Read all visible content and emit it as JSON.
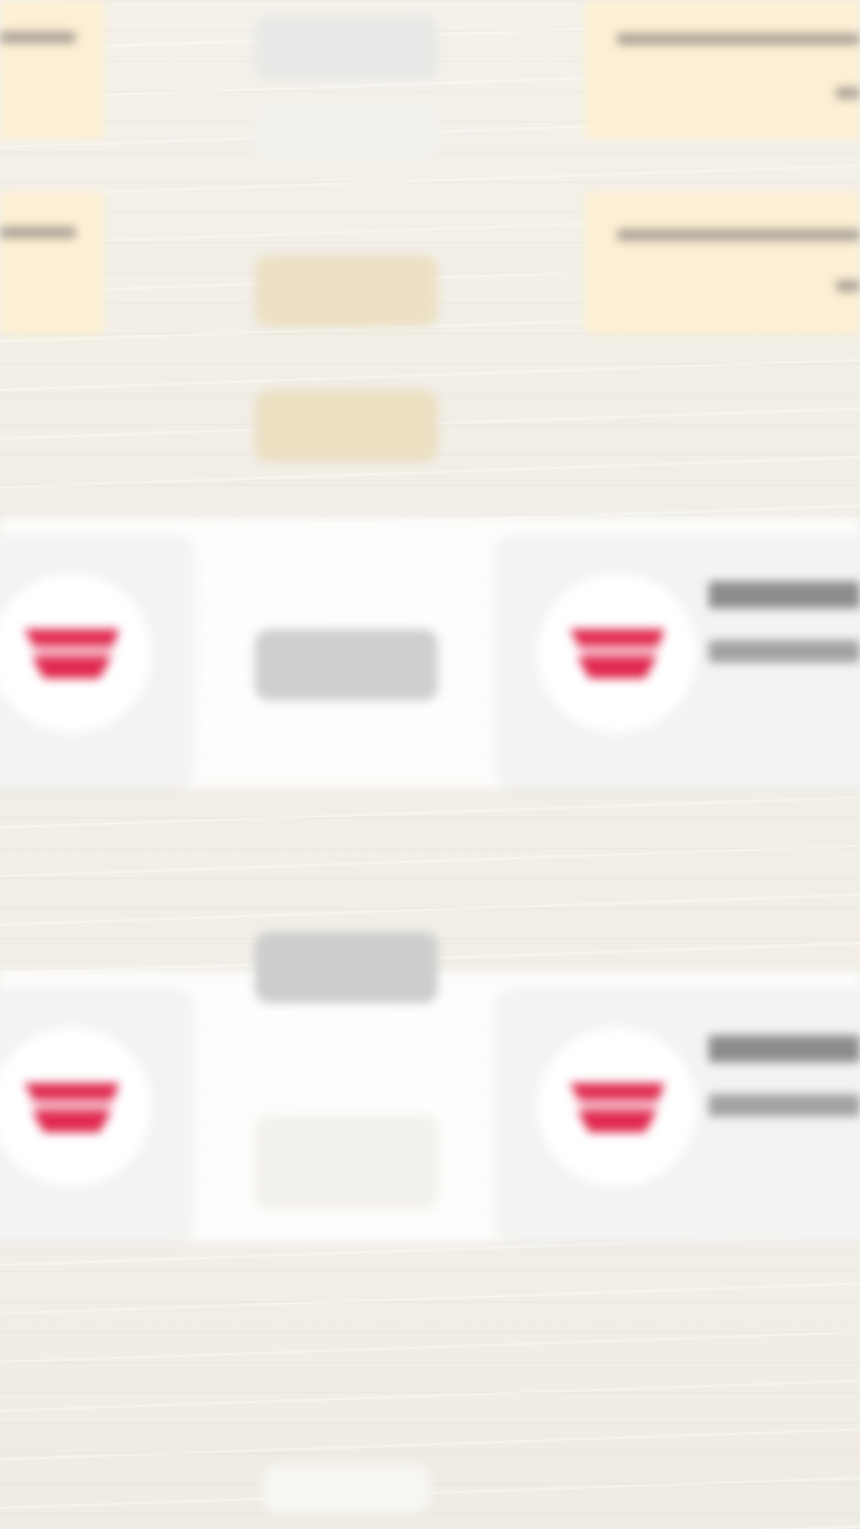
{
  "colors": {
    "background": "#f1efe8",
    "note_background": "#fdefd3",
    "card_background": "#f4f3f2",
    "logo_red": "#e0294f",
    "logo_pink": "#f5b7c5"
  },
  "icons": {
    "card_logo": "red-wing-logo-icon"
  },
  "cards": [
    {
      "position": "left-top"
    },
    {
      "position": "right-top"
    },
    {
      "position": "left-bottom"
    },
    {
      "position": "right-bottom"
    }
  ],
  "notes": [
    {
      "position": "left-top"
    },
    {
      "position": "left-middle"
    },
    {
      "position": "right-top"
    },
    {
      "position": "right-middle"
    }
  ]
}
